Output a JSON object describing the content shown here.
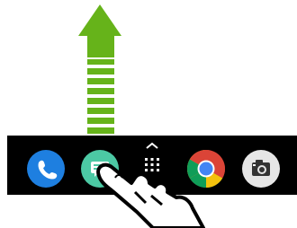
{
  "gesture": {
    "type": "swipe-up",
    "arrow_color": "#66b31a",
    "arrow_stripe_color": "#ffffff",
    "hand_icon": "hand-pointer-icon"
  },
  "dock": {
    "background": "#000000",
    "apps": [
      {
        "icon": "phone-icon",
        "color": "#1e7fe0"
      },
      {
        "icon": "messages-icon",
        "color": "#4cc9a4"
      },
      {
        "icon": "app-drawer-icon",
        "color": "#ffffff"
      },
      {
        "icon": "chrome-icon",
        "color": "#db4437"
      },
      {
        "icon": "camera-icon",
        "color": "#e6e6e6"
      }
    ]
  }
}
